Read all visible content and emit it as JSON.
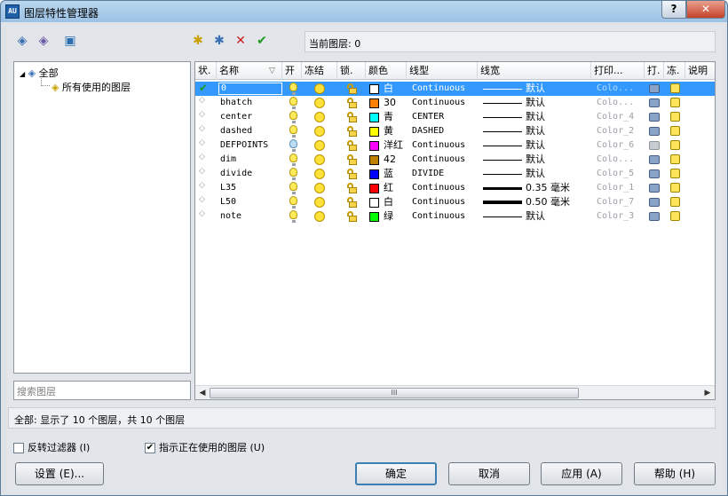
{
  "window": {
    "title": "图层特性管理器",
    "help_label": "?",
    "close_label": "✕"
  },
  "toolbar": {
    "icons": [
      "new-property-filter-icon",
      "new-group-filter-icon",
      "layer-states-manager-icon",
      "new-layer-icon",
      "new-layer-vp-frozen-icon",
      "delete-layer-icon",
      "set-current-icon"
    ],
    "delete_glyph": "✕",
    "current_glyph": "✔",
    "current_layer_label": "当前图层: 0"
  },
  "tree": {
    "root_label": "全部",
    "child_label": "所有使用的图层",
    "search_placeholder": "搜索图层"
  },
  "grid": {
    "headers": [
      "状.",
      "名称",
      "▽",
      "开",
      "冻结",
      "锁.",
      "颜色",
      "线型",
      "线宽",
      "打印...",
      "打.",
      "冻.",
      "说明"
    ],
    "rows": [
      {
        "name": "0",
        "on": true,
        "color_name": "白",
        "color_hex": "#ffffff",
        "linetype": "Continuous",
        "lineweight": "默认",
        "plot_style": "Colo...",
        "current": true
      },
      {
        "name": "bhatch",
        "on": true,
        "color_name": "30",
        "color_hex": "#ff7f00",
        "linetype": "Continuous",
        "lineweight": "默认",
        "plot_style": "Colo...",
        "current": false
      },
      {
        "name": "center",
        "on": true,
        "color_name": "青",
        "color_hex": "#00ffff",
        "linetype": "CENTER",
        "lineweight": "默认",
        "plot_style": "Color_4",
        "current": false
      },
      {
        "name": "dashed",
        "on": true,
        "color_name": "黄",
        "color_hex": "#ffff00",
        "linetype": "DASHED",
        "lineweight": "默认",
        "plot_style": "Color_2",
        "current": false
      },
      {
        "name": "DEFPOINTS",
        "on": false,
        "color_name": "洋红",
        "color_hex": "#ff00ff",
        "linetype": "Continuous",
        "lineweight": "默认",
        "plot_style": "Color_6",
        "current": false
      },
      {
        "name": "dim",
        "on": true,
        "color_name": "42",
        "color_hex": "#bf8000",
        "linetype": "Continuous",
        "lineweight": "默认",
        "plot_style": "Colo...",
        "current": false
      },
      {
        "name": "divide",
        "on": true,
        "color_name": "蓝",
        "color_hex": "#0000ff",
        "linetype": "DIVIDE",
        "lineweight": "默认",
        "plot_style": "Color_5",
        "current": false
      },
      {
        "name": "L35",
        "on": true,
        "color_name": "红",
        "color_hex": "#ff0000",
        "linetype": "Continuous",
        "lineweight": "0.35 毫米",
        "plot_style": "Color_1",
        "current": false
      },
      {
        "name": "L50",
        "on": true,
        "color_name": "白",
        "color_hex": "#ffffff",
        "linetype": "Continuous",
        "lineweight": "0.50 毫米",
        "plot_style": "Color_7",
        "current": false
      },
      {
        "name": "note",
        "on": true,
        "color_name": "绿",
        "color_hex": "#00ff00",
        "linetype": "Continuous",
        "lineweight": "默认",
        "plot_style": "Color_3",
        "current": false
      }
    ],
    "scroll_left": "◀",
    "scroll_right": "▶",
    "scroll_grip": "III"
  },
  "status": {
    "text": "全部: 显示了 10 个图层，共 10 个图层"
  },
  "options": {
    "invert_filter": {
      "label": "反转过滤器 (I)",
      "checked": false
    },
    "indicate_in_use": {
      "label": "指示正在使用的图层 (U)",
      "checked": true,
      "check_glyph": "✔"
    }
  },
  "buttons": {
    "settings": "设置 (E)...",
    "ok": "确定",
    "cancel": "取消",
    "apply": "应用 (A)",
    "help": "帮助 (H)"
  },
  "colors": {
    "selection": "#3399ff",
    "title_gradient": "#9cc2e5"
  }
}
